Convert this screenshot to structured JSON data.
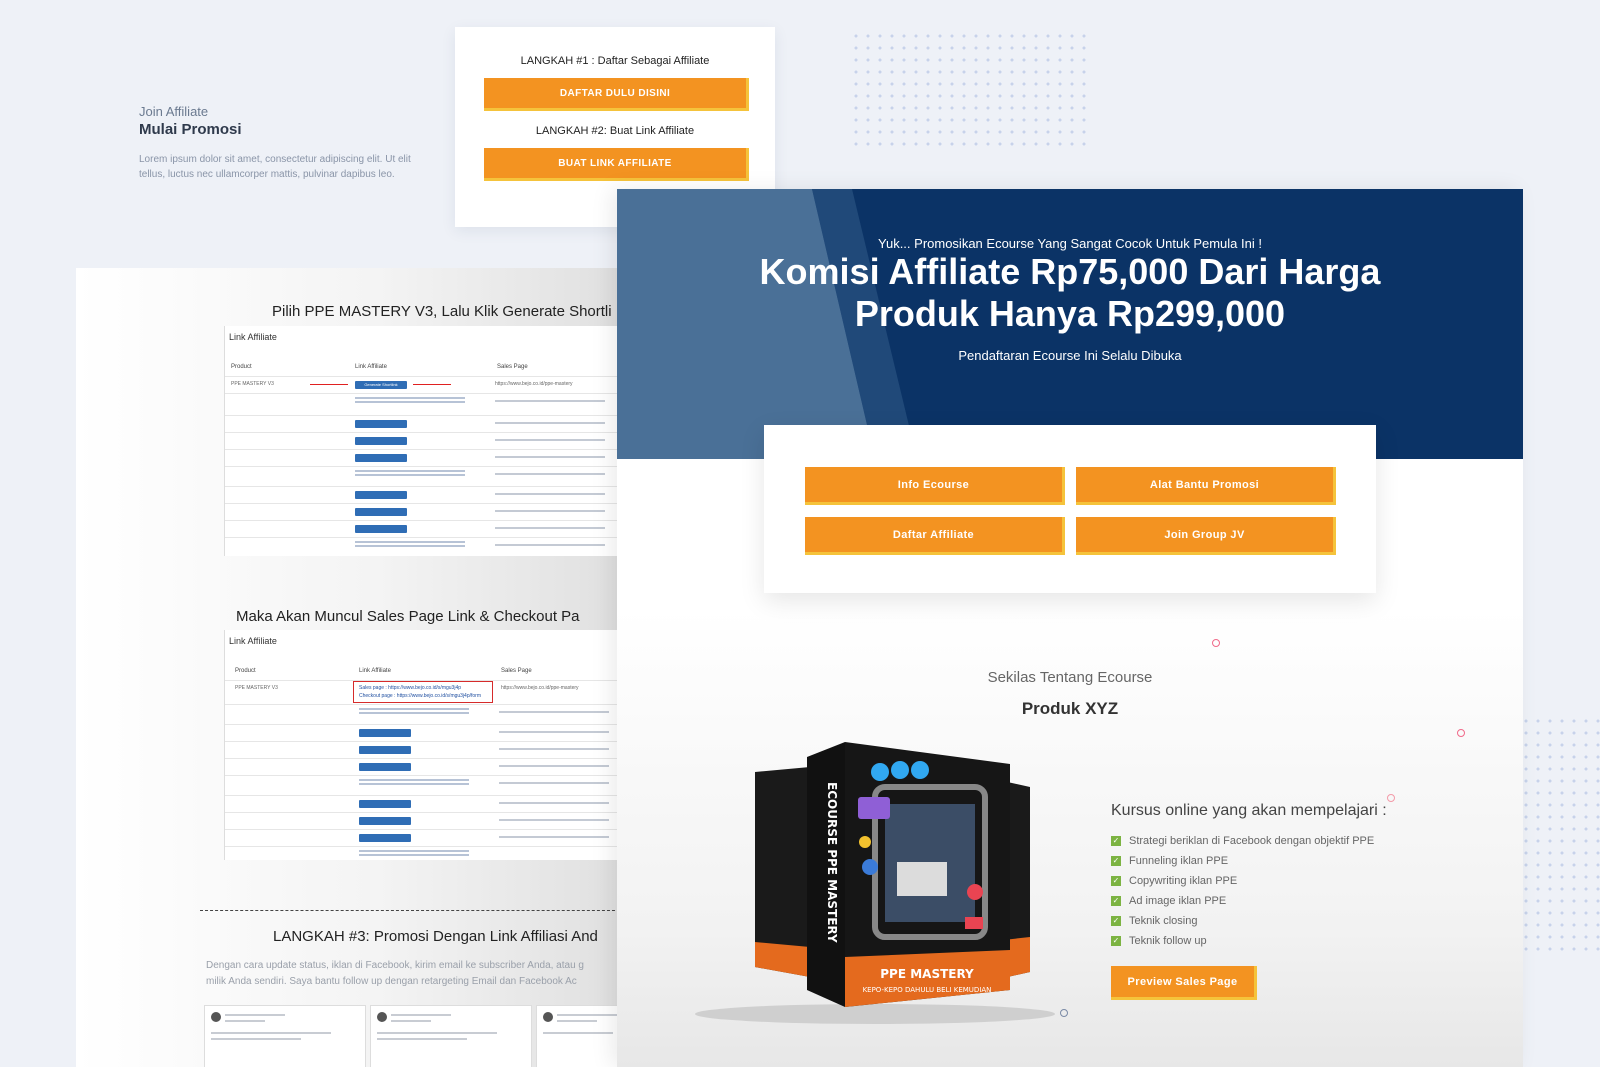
{
  "intro": {
    "eyebrow": "Join Affiliate",
    "title": "Mulai Promosi",
    "desc_line1": "Lorem ipsum dolor sit amet, consectetur adipiscing elit. Ut elit",
    "desc_line2": "tellus, luctus nec ullamcorper mattis, pulvinar dapibus leo."
  },
  "steps": {
    "step1_label": "LANGKAH #1 : Daftar Sebagai Affiliate",
    "step1_button": "DAFTAR DULU DISINI",
    "step2_label": "LANGKAH #2: Buat Link Affiliate",
    "step2_button": "BUAT LINK AFFILIATE"
  },
  "left_panel": {
    "heading1": "Pilih PPE MASTERY V3, Lalu Klik Generate Shortli",
    "heading2": "Maka Akan Muncul Sales Page Link & Checkout Pa",
    "heading3": "LANGKAH #3: Promosi Dengan Link Affiliasi And",
    "para_line1": "Dengan cara update status, iklan di Facebook, kirim email ke subscriber Anda, atau g",
    "para_line2": "milik Anda sendiri. Saya bantu follow up dengan retargeting Email dan Facebook Ac",
    "table1": {
      "title": "Link Affiliate",
      "columns": [
        "Product",
        "Link Affiliate",
        "Sales Page"
      ],
      "first_product": "PPE MASTERY V3",
      "first_button": "Generate Shortlink",
      "first_url": "https://www.bejo.co.id/ppe-mastery"
    },
    "table2": {
      "title": "Link Affiliate",
      "columns": [
        "Product",
        "Link Affiliate",
        "Sales Page"
      ],
      "first_product": "PPE MASTERY V3",
      "sales_line": "Sales page : https://www.bejo.co.id/s/mgu3j4p",
      "checkout_line": "Checkout page : https://www.bejo.co.id/s/mgu3j4p/form",
      "first_url": "https://www.bejo.co.id/ppe-mastery"
    }
  },
  "hero": {
    "kicker": "Yuk... Promosikan Ecourse Yang Sangat Cocok Untuk Pemula Ini !",
    "title_line1": "Komisi Affiliate Rp75,000 Dari Harga",
    "title_line2": "Produk Hanya Rp299,000",
    "subtitle": "Pendaftaran Ecourse Ini Selalu Dibuka"
  },
  "menu": {
    "btn1": "Info Ecourse",
    "btn2": "Alat Bantu Promosi",
    "btn3": "Daftar Affiliate",
    "btn4": "Join Group JV"
  },
  "about": {
    "eyebrow": "Sekilas Tentang Ecourse",
    "title": "Produk XYZ"
  },
  "product_box": {
    "spine": "ECOURSE PPE MASTERY",
    "name": "PPE MASTERY",
    "tagline": "KEPO-KEPO DAHULU BELI KEMUDIAN"
  },
  "course": {
    "heading": "Kursus online yang akan mempelajari :",
    "features": [
      "Strategi beriklan di Facebook dengan objektif PPE",
      "Funneling iklan PPE",
      "Copywriting iklan PPE",
      "Ad image iklan PPE",
      "Teknik closing",
      "Teknik follow up"
    ],
    "cta": "Preview Sales Page"
  },
  "colors": {
    "accent": "#f39321",
    "accent_shadow": "#f5c33b",
    "hero_navy": "#0b3366",
    "check_green": "#7cb342"
  }
}
